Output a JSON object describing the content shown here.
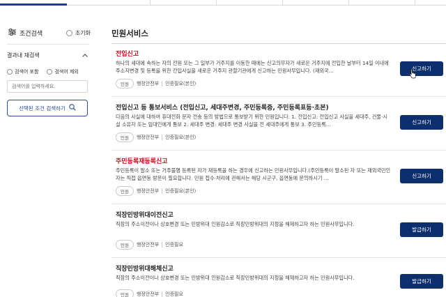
{
  "sidebar": {
    "filter_title": "조건검색",
    "reset_label": "초기화",
    "sub_heading": "결과내 재검색",
    "option_include": "검색어 포함",
    "option_exclude": "검색어 제외",
    "keyword_placeholder": "검색어를 입력하세요.",
    "search_button_label": "선택된 조건 검색하기"
  },
  "main": {
    "title": "민원서비스"
  },
  "cards": [
    {
      "title": "전입신고",
      "desc": "하나의 세대에 속하는 자의 전원 또는 그 일부가 거주지를 이동한 때에는 신고의무자가 새로운 거주지에 전입한 날부터 14일 이내에 주소지변경 및 등록을 위한 전입사실을 새로운 거주지 관할기관에게 신고하는 민원사무입니다. (재외국…",
      "tag": "민원",
      "agency": "행정안전부",
      "auth": "인증필요(본인)",
      "button": "신고하기"
    },
    {
      "title": "전입신고 등 통보서비스 (전입신고, 세대주변경, 주민등록증, 주민등록표등·초본)",
      "desc": "다음의 사실에 대하여 휴대전화 문자 전송 등의 방법으로 통보받기 위한 민원입니다. 1. 전입신고: 전입신고 사실을 세대주, 건물·시설 소유자 또는 임대인에게 통보 2. 세대주 변경: 세대주 변경 사실을 전 세대주에게 통보 3. 주민등록…",
      "tag": "민원",
      "agency": "행정안전부",
      "auth": "인증필요(본인)",
      "button": "신고하기"
    },
    {
      "title": "주민등록재등록신고",
      "desc": "주민등록이 말소 또는 거주불명 등록된 자가 재등록을 하는 경우에 신고하는 민원사무입니다.(주민등록이 말소된 자 또는 재외국민인 자는 직접 읍면동 방문이 필요합니다. 민원 접수·처리에 관해서는 해당 시군구, 읍면동에 문의하시기 …",
      "tag": "민원",
      "agency": "행정안전부",
      "auth": "인증필요(본인)",
      "button": "신고하기"
    },
    {
      "title": "직장민방위대이전신고",
      "desc": "직장의 주소이전이나 상호변경 또는 민방위대 인원감소로 직장민방위대의 지정을 해제하고자 하는 민원사무입니다.",
      "tag": "민원",
      "agency": "행정안전부",
      "auth": "인증필요",
      "button": "발급하기"
    },
    {
      "title": "직장민방위대해체신고",
      "desc": "직장의 주소이전이나 상호변경 또는 민방위대 인원감소로 직장민방위대의 지정을 해제하고자 하는 민원사무입니다.",
      "tag": "민원",
      "agency": "행정안전부",
      "auth": "인증필요",
      "button": "발급하기"
    }
  ],
  "colors": {
    "accent": "#0e2f6e",
    "highlight": "#d0021b",
    "outline_button": "#2a4ea0"
  }
}
